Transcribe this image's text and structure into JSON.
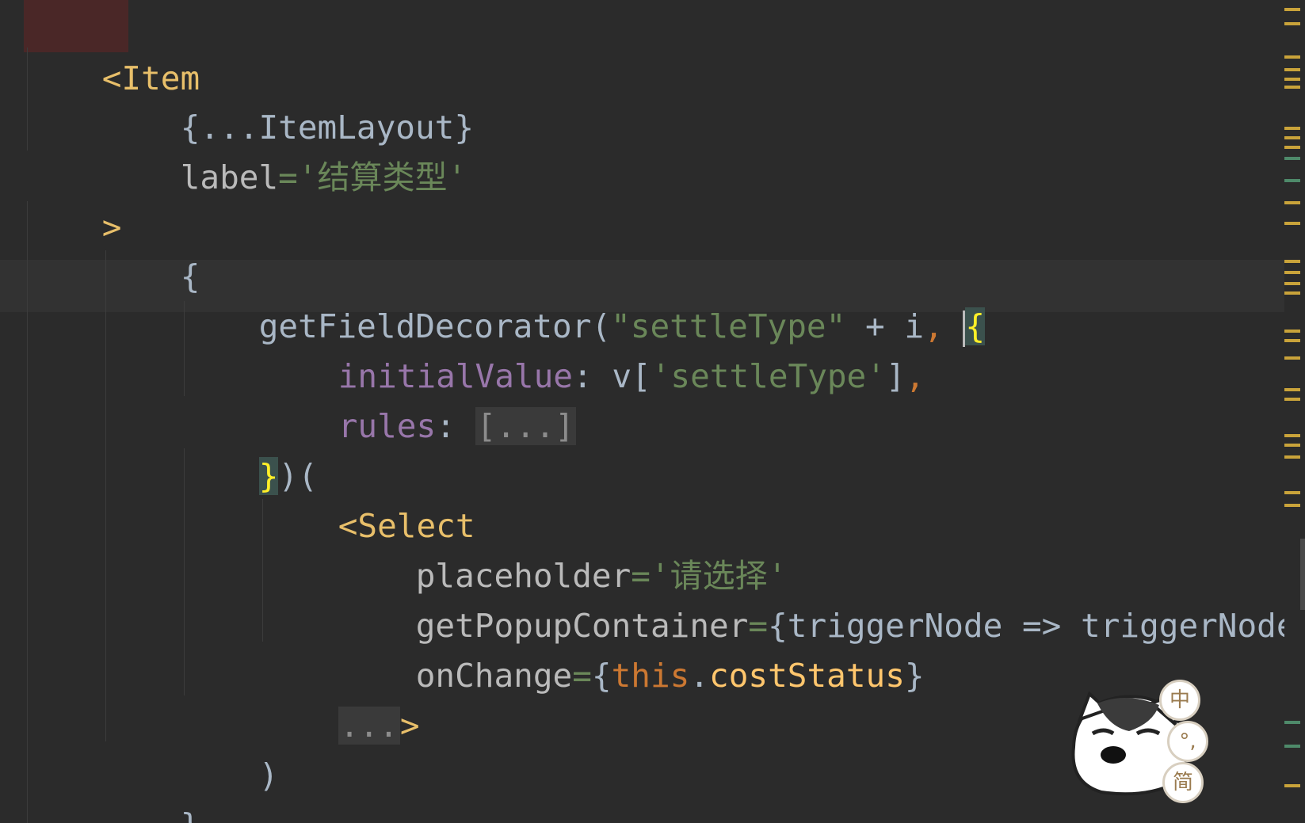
{
  "editor": {
    "lines": {
      "l1": {
        "open": "<Item"
      },
      "l2": {
        "spread": "{...ItemLayout}"
      },
      "l3": {
        "attr": "label",
        "eq": "=",
        "value": "'结算类型'"
      },
      "l4": {
        "close": ">"
      },
      "l5": {
        "brace": "{"
      },
      "l6": {
        "func": "getFieldDecorator(",
        "str": "\"settleType\"",
        "rest": " + i",
        "comma": ", ",
        "brace": "{"
      },
      "l7": {
        "prop": "initialValue",
        "colon": ": ",
        "expr": "v[",
        "str": "'settleType'",
        "end": "]",
        "comma": ","
      },
      "l8": {
        "prop": "rules",
        "colon": ": ",
        "fold": "[...]"
      },
      "l9": {
        "brace": "}",
        "rest": ")("
      },
      "l10": {
        "open": "<Select"
      },
      "l11": {
        "attr": "placeholder",
        "eq": "=",
        "value": "'请选择'"
      },
      "l12": {
        "attr": "getPopupContainer",
        "eq": "=",
        "value": "{triggerNode => triggerNode}"
      },
      "l13": {
        "attr": "onChange",
        "eq": "=",
        "open": "{",
        "kw": "this",
        "dot": ".",
        "member": "costStatus",
        "close": "}"
      },
      "l14": {
        "fold": "...",
        "close": ">"
      },
      "l15": {
        "paren": ")"
      },
      "l16": {
        "brace": "}"
      }
    }
  },
  "ime": {
    "mode_label": "中",
    "punct_label": "°,",
    "script_label": "简",
    "mascot_icon": "husky-mascot-icon"
  },
  "colors": {
    "background": "#2b2b2b",
    "tag": "#e8bf6a",
    "string": "#6a8759",
    "property": "#9876aa",
    "keyword": "#cc7832",
    "member": "#ffc66d",
    "brace_match": "#ffef28"
  }
}
